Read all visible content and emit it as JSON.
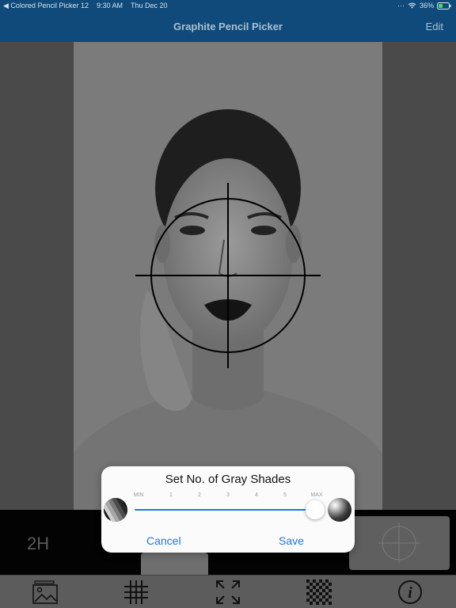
{
  "status_bar": {
    "back_app": "◀ Colored Pencil Picker 12",
    "time": "9:30 AM",
    "date": "Thu Dec 20",
    "battery": "36%"
  },
  "nav": {
    "title": "Graphite Pencil Picker",
    "edit_label": "Edit"
  },
  "info": {
    "pencil_grade": "2H"
  },
  "alert": {
    "title": "Set No. of Gray Shades",
    "slider": {
      "tick_labels": [
        "MIN",
        "1",
        "2",
        "3",
        "4",
        "5",
        "MAX"
      ],
      "value": 1.0
    },
    "cancel_label": "Cancel",
    "save_label": "Save"
  },
  "toolbar": {
    "icons": [
      "image-library-icon",
      "grid-icon",
      "expand-icon",
      "checkerboard-icon",
      "info-icon"
    ]
  },
  "colors": {
    "nav_background": "#0f4a7a",
    "accent_blue": "#1a7ae0"
  }
}
